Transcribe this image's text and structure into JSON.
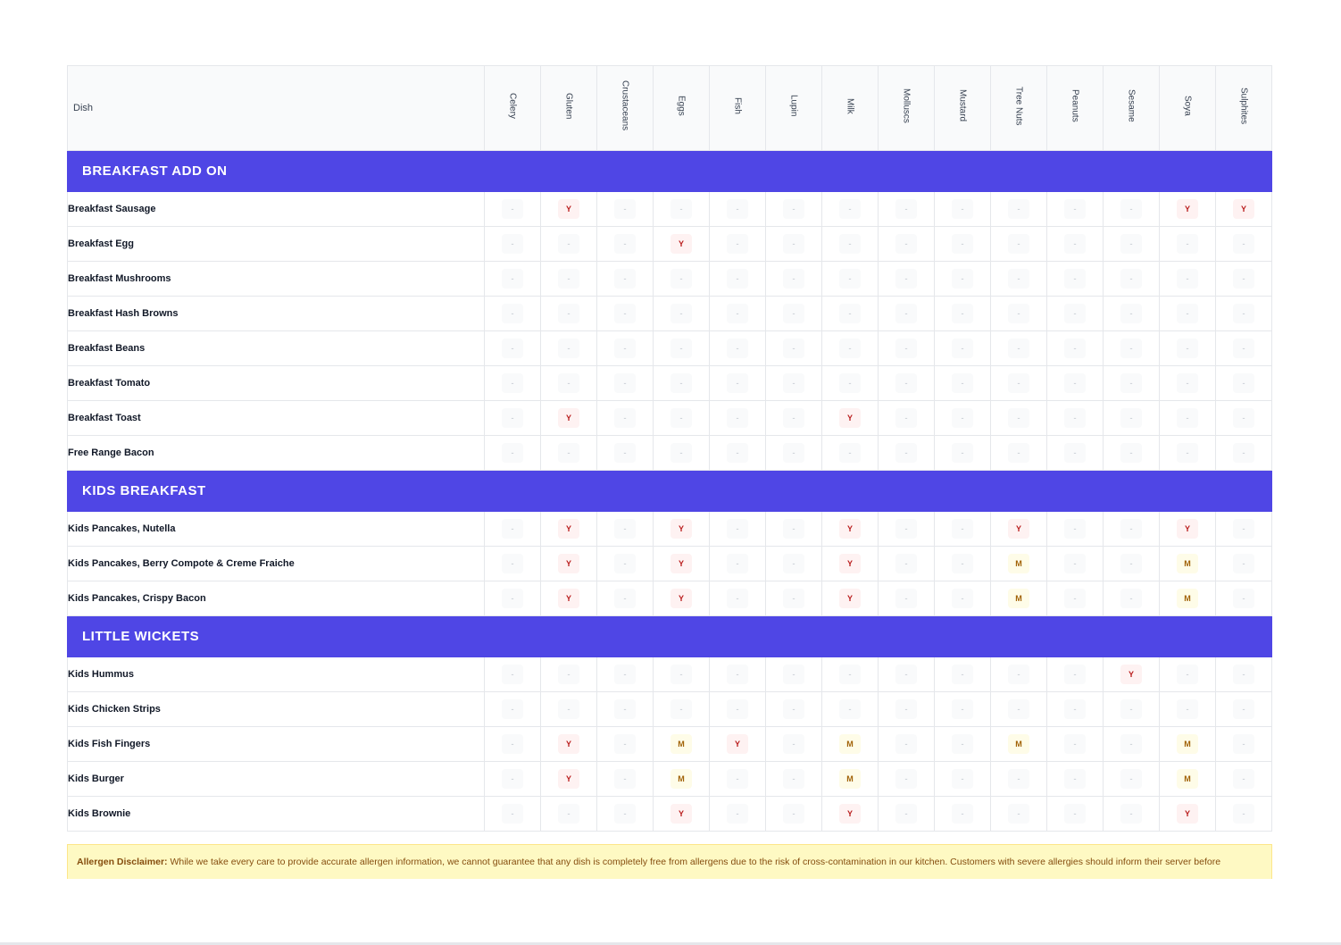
{
  "table": {
    "dish_header": "Dish",
    "allergens": [
      "Celery",
      "Gluten",
      "Crustaceans",
      "Eggs",
      "Fish",
      "Lupin",
      "Milk",
      "Molluscs",
      "Mustard",
      "Tree Nuts",
      "Peanuts",
      "Sesame",
      "Soya",
      "Sulphites"
    ],
    "empty_mark": "-",
    "sections": [
      {
        "title": "BREAKFAST ADD ON",
        "rows": [
          {
            "dish": "Breakfast Sausage",
            "cells": [
              "-",
              "Y",
              "-",
              "-",
              "-",
              "-",
              "-",
              "-",
              "-",
              "-",
              "-",
              "-",
              "Y",
              "Y"
            ]
          },
          {
            "dish": "Breakfast Egg",
            "cells": [
              "-",
              "-",
              "-",
              "Y",
              "-",
              "-",
              "-",
              "-",
              "-",
              "-",
              "-",
              "-",
              "-",
              "-"
            ]
          },
          {
            "dish": "Breakfast Mushrooms",
            "cells": [
              "-",
              "-",
              "-",
              "-",
              "-",
              "-",
              "-",
              "-",
              "-",
              "-",
              "-",
              "-",
              "-",
              "-"
            ]
          },
          {
            "dish": "Breakfast Hash Browns",
            "cells": [
              "-",
              "-",
              "-",
              "-",
              "-",
              "-",
              "-",
              "-",
              "-",
              "-",
              "-",
              "-",
              "-",
              "-"
            ]
          },
          {
            "dish": "Breakfast Beans",
            "cells": [
              "-",
              "-",
              "-",
              "-",
              "-",
              "-",
              "-",
              "-",
              "-",
              "-",
              "-",
              "-",
              "-",
              "-"
            ]
          },
          {
            "dish": "Breakfast Tomato",
            "cells": [
              "-",
              "-",
              "-",
              "-",
              "-",
              "-",
              "-",
              "-",
              "-",
              "-",
              "-",
              "-",
              "-",
              "-"
            ]
          },
          {
            "dish": "Breakfast Toast",
            "cells": [
              "-",
              "Y",
              "-",
              "-",
              "-",
              "-",
              "Y",
              "-",
              "-",
              "-",
              "-",
              "-",
              "-",
              "-"
            ]
          },
          {
            "dish": "Free Range Bacon",
            "cells": [
              "-",
              "-",
              "-",
              "-",
              "-",
              "-",
              "-",
              "-",
              "-",
              "-",
              "-",
              "-",
              "-",
              "-"
            ]
          }
        ]
      },
      {
        "title": "KIDS BREAKFAST",
        "rows": [
          {
            "dish": "Kids Pancakes, Nutella",
            "cells": [
              "-",
              "Y",
              "-",
              "Y",
              "-",
              "-",
              "Y",
              "-",
              "-",
              "Y",
              "-",
              "-",
              "Y",
              "-"
            ]
          },
          {
            "dish": "Kids Pancakes, Berry Compote & Creme Fraiche",
            "cells": [
              "-",
              "Y",
              "-",
              "Y",
              "-",
              "-",
              "Y",
              "-",
              "-",
              "M",
              "-",
              "-",
              "M",
              "-"
            ]
          },
          {
            "dish": "Kids Pancakes, Crispy Bacon",
            "cells": [
              "-",
              "Y",
              "-",
              "Y",
              "-",
              "-",
              "Y",
              "-",
              "-",
              "M",
              "-",
              "-",
              "M",
              "-"
            ]
          }
        ]
      },
      {
        "title": "LITTLE WICKETS",
        "rows": [
          {
            "dish": "Kids Hummus",
            "cells": [
              "-",
              "-",
              "-",
              "-",
              "-",
              "-",
              "-",
              "-",
              "-",
              "-",
              "-",
              "Y",
              "-",
              "-"
            ]
          },
          {
            "dish": "Kids Chicken Strips",
            "cells": [
              "-",
              "-",
              "-",
              "-",
              "-",
              "-",
              "-",
              "-",
              "-",
              "-",
              "-",
              "-",
              "-",
              "-"
            ]
          },
          {
            "dish": "Kids Fish Fingers",
            "cells": [
              "-",
              "Y",
              "-",
              "M",
              "Y",
              "-",
              "M",
              "-",
              "-",
              "M",
              "-",
              "-",
              "M",
              "-"
            ]
          },
          {
            "dish": "Kids Burger",
            "cells": [
              "-",
              "Y",
              "-",
              "M",
              "-",
              "-",
              "M",
              "-",
              "-",
              "-",
              "-",
              "-",
              "M",
              "-"
            ]
          },
          {
            "dish": "Kids Brownie",
            "cells": [
              "-",
              "-",
              "-",
              "Y",
              "-",
              "-",
              "Y",
              "-",
              "-",
              "-",
              "-",
              "-",
              "Y",
              "-"
            ]
          }
        ]
      }
    ]
  },
  "disclaimer": {
    "label": "Allergen Disclaimer:",
    "text": "While we take every care to provide accurate allergen information, we cannot guarantee that any dish is completely free from allergens due to the risk of cross-contamination in our kitchen. Customers with severe allergies should inform their server before"
  },
  "colors": {
    "section_band": "#4f46e5",
    "contains_badge_bg": "#fef2f2",
    "contains_badge_text": "#b91c1c",
    "may_contain_badge_bg": "#fefce8",
    "may_contain_badge_text": "#a16207",
    "disclaimer_bg": "#fef9c3"
  }
}
